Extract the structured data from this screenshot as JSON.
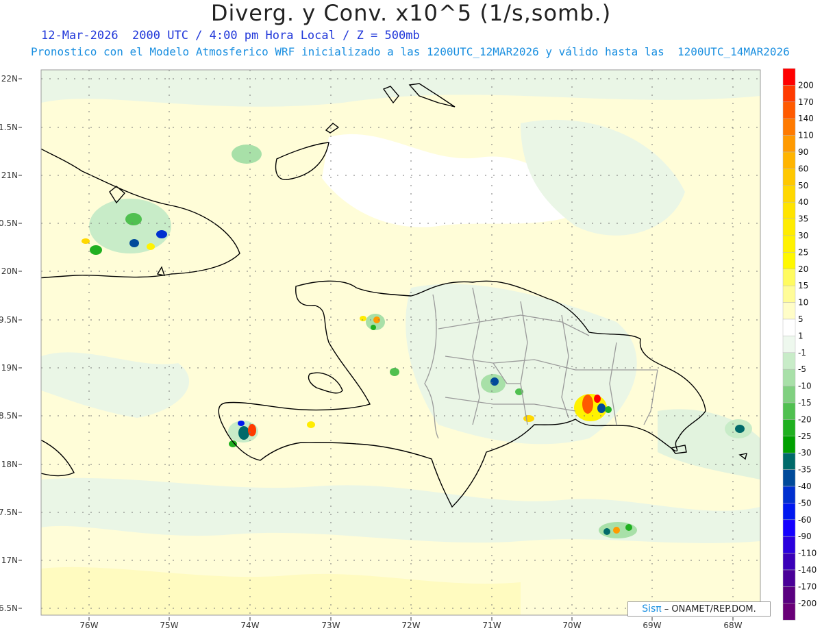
{
  "title": "Diverg. y Conv. x10^5 (1/s,somb.)",
  "subtitle_line1": "12-Mar-2026  2000 UTC / 4:00 pm Hora Local / Z = 500mb",
  "subtitle_line2": "Pronostico con el Modelo Atmosferico WRF inicializado a las 1200UTC_12MAR2026 y válido hasta las  1200UTC_14MAR2026",
  "lat_labels": [
    "22N",
    "1.5N",
    "21N",
    "0.5N",
    "20N",
    "9.5N",
    "19N",
    "8.5N",
    "18N",
    "7.5N",
    "17N",
    "6.5N"
  ],
  "lon_labels": [
    "76W",
    "75W",
    "74W",
    "73W",
    "72W",
    "71W",
    "70W",
    "69W",
    "68W"
  ],
  "colorbar": [
    {
      "label": "200",
      "color": "#ff0000"
    },
    {
      "label": "170",
      "color": "#ff3a00"
    },
    {
      "label": "140",
      "color": "#ff5a00"
    },
    {
      "label": "110",
      "color": "#ff7a00"
    },
    {
      "label": "90",
      "color": "#ff9a00"
    },
    {
      "label": "60",
      "color": "#ffb400"
    },
    {
      "label": "50",
      "color": "#ffc800"
    },
    {
      "label": "40",
      "color": "#ffd800"
    },
    {
      "label": "35",
      "color": "#ffe400"
    },
    {
      "label": "30",
      "color": "#ffec00"
    },
    {
      "label": "25",
      "color": "#fff200"
    },
    {
      "label": "20",
      "color": "#fff800"
    },
    {
      "label": "15",
      "color": "#fffb60"
    },
    {
      "label": "10",
      "color": "#fffc98"
    },
    {
      "label": "5",
      "color": "#fffdc8"
    },
    {
      "label": "1",
      "color": "#ffffff"
    },
    {
      "label": "-1",
      "color": "#eef8ee"
    },
    {
      "label": "-5",
      "color": "#c8ecc8"
    },
    {
      "label": "-10",
      "color": "#a8e0a8"
    },
    {
      "label": "-15",
      "color": "#80d080"
    },
    {
      "label": "-20",
      "color": "#50c050"
    },
    {
      "label": "-25",
      "color": "#20b020"
    },
    {
      "label": "-30",
      "color": "#00a000"
    },
    {
      "label": "-35",
      "color": "#006a6a"
    },
    {
      "label": "-40",
      "color": "#004a9a"
    },
    {
      "label": "-50",
      "color": "#0030d0"
    },
    {
      "label": "-60",
      "color": "#0018f0"
    },
    {
      "label": "-90",
      "color": "#1400ff"
    },
    {
      "label": "-110",
      "color": "#2a00dd"
    },
    {
      "label": "-140",
      "color": "#3a00b8"
    },
    {
      "label": "-170",
      "color": "#4a0098"
    },
    {
      "label": "-200",
      "color": "#5a0080"
    },
    {
      "label": "",
      "color": "#6a0078"
    }
  ],
  "credit_brand": "Sisπ",
  "credit_text": "– ONAMET/REP.DOM."
}
